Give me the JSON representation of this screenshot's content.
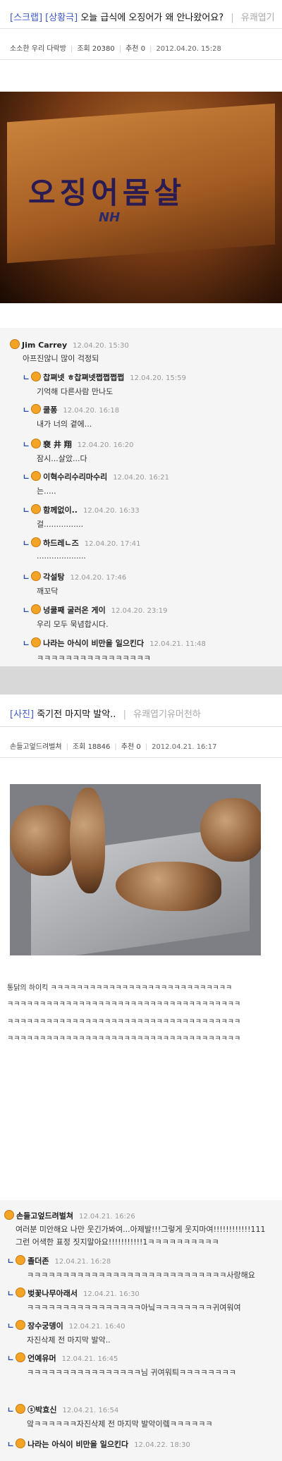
{
  "post1": {
    "tag": "[스크랩]",
    "board": "[상황극]",
    "subject": "오늘 급식에 오징어가 왜 안나왔어요?",
    "category": "유쾌엽기",
    "author": "소소한 우리 다락방",
    "views": "조회 20380",
    "likes": "추천 0",
    "date": "2012.04.20. 15:28",
    "photo_text": "오징어몸살",
    "photo_brand": "NH",
    "comments": [
      {
        "nick": "Jim Carrey",
        "date": "12.04.20. 15:30",
        "text": "아프진않니 많이 걱정되"
      },
      {
        "nick": "찹쪄넷 ㅎ찹쪄넷쩝쩝쩝쩝",
        "date": "12.04.20. 15:59",
        "text": "기억해 다른사람 만나도"
      },
      {
        "nick": "쿨퐁",
        "date": "12.04.20. 16:18",
        "text": "내가 너의 곁에..."
      },
      {
        "nick": "裵 井 翔",
        "date": "12.04.20. 16:20",
        "text": "잠시...살았...다"
      },
      {
        "nick": "이혁수리수리마수리",
        "date": "12.04.20. 16:21",
        "text": "는....."
      },
      {
        "nick": "함께없이..",
        "date": "12.04.20. 16:33",
        "text": "걸................"
      },
      {
        "nick": "하드레ㄴ즈",
        "date": "12.04.20. 17:41",
        "text": "...................."
      },
      {
        "nick": "각설탕",
        "date": "12.04.20. 17:46",
        "text": "깨꼬닥"
      },
      {
        "nick": "넝쿨째 굴러온 게이",
        "date": "12.04.20. 23:19",
        "text": "우리 모두 묵념합시다."
      },
      {
        "nick": "나라는 아식이 비만을 일으킨다",
        "date": "12.04.21. 11:48",
        "text": "ㅋㅋㅋㅋㅋㅋㅋㅋㅋㅋㅋㅋㅋㅋㅋㅋ"
      }
    ]
  },
  "post2": {
    "board": "[사진]",
    "subject": "죽기전 마지막 발악..",
    "category": "유쾌엽기유머천하",
    "author": "손들고엎드려벌쳐",
    "views": "조회 18846",
    "likes": "추천 0",
    "date": "2012.04.21. 16:17",
    "body": [
      "통닭의 하이킥 ㅋㅋㅋㅋㅋㅋㅋㅋㅋㅋㅋㅋㅋㅋㅋㅋㅋㅋㅋㅋㅋㅋㅋㅋㅋㅋㅋㅋ",
      "ㅋㅋㅋㅋㅋㅋㅋㅋㅋㅋㅋㅋㅋㅋㅋㅋㅋㅋㅋㅋㅋㅋㅋㅋㅋㅋㅋㅋㅋㅋㅋㅋㅋㅋㅋㅋ",
      "ㅋㅋㅋㅋㅋㅋㅋㅋㅋㅋㅋㅋㅋㅋㅋㅋㅋㅋㅋㅋㅋㅋㅋㅋㅋㅋㅋㅋㅋㅋㅋㅋㅋㅋㅋㅋ",
      "ㅋㅋㅋㅋㅋㅋㅋㅋㅋㅋㅋㅋㅋㅋㅋㅋㅋㅋㅋㅋㅋㅋㅋㅋㅋㅋㅋㅋㅋㅋㅋㅋㅋㅋㅋㅋ"
    ],
    "comments": [
      {
        "nick": "손들고엎드려벌쳐",
        "date": "12.04.21. 16:26",
        "text": "여러분 미안해요 나만 웃긴가봐여...아제발!!!그렇게 웃지마여!!!!!!!!!!!!111",
        "text2": "그런 어색한 표정 짓지말아요!!!!!!!!!!!1ㅋㅋㅋㅋㅋㅋㅋㅋㅋㅋ"
      },
      {
        "nick": "졸더존",
        "date": "12.04.21. 16:28",
        "text": "ㅋㅋㅋㅋㅋㅋㅋㅋㅋㅋㅋㅋㅋㅋㅋㅋㅋㅋㅋㅋㅋㅋㅋㅋㅋㅋㅋㅋ사랑해요"
      },
      {
        "nick": "벚꽃나무아래서",
        "date": "12.04.21. 16:30",
        "text": "ㅋㅋㅋㅋㅋㅋㅋㅋㅋㅋㅋㅋㅋㅋㅋㅋ아닠ㅋㅋㅋㅋㅋㅋㅋㅋ귀여워여"
      },
      {
        "nick": "장수궁뎅이",
        "date": "12.04.21. 16:40",
        "text": "자진삭제 전 마지막 발악.."
      },
      {
        "nick": "언예유머",
        "date": "12.04.21. 16:45",
        "text": "ㅋㅋㅋㅋㅋㅋㅋㅋㅋㅋㅋㅋㅋㅋㅋㅋ님 귀여워틔ㅋㅋㅋㅋㅋㅋㅋㅋ"
      },
      {
        "nick": "ⓢ박효신",
        "date": "12.04.21. 16:54",
        "text": "앜ㅋㅋㅋㅋㅋㅋ자진삭제 전 마지막 발악이렠ㅋㅋㅋㅋㅋㅋ"
      },
      {
        "nick": "나라는 아식이 비만을 일으킨다",
        "date": "12.04.22. 18:30",
        "text": ""
      }
    ]
  },
  "colors": {
    "tag": "#3d57c8",
    "reply": "#2a4ea8",
    "icon": "#f3a326"
  }
}
